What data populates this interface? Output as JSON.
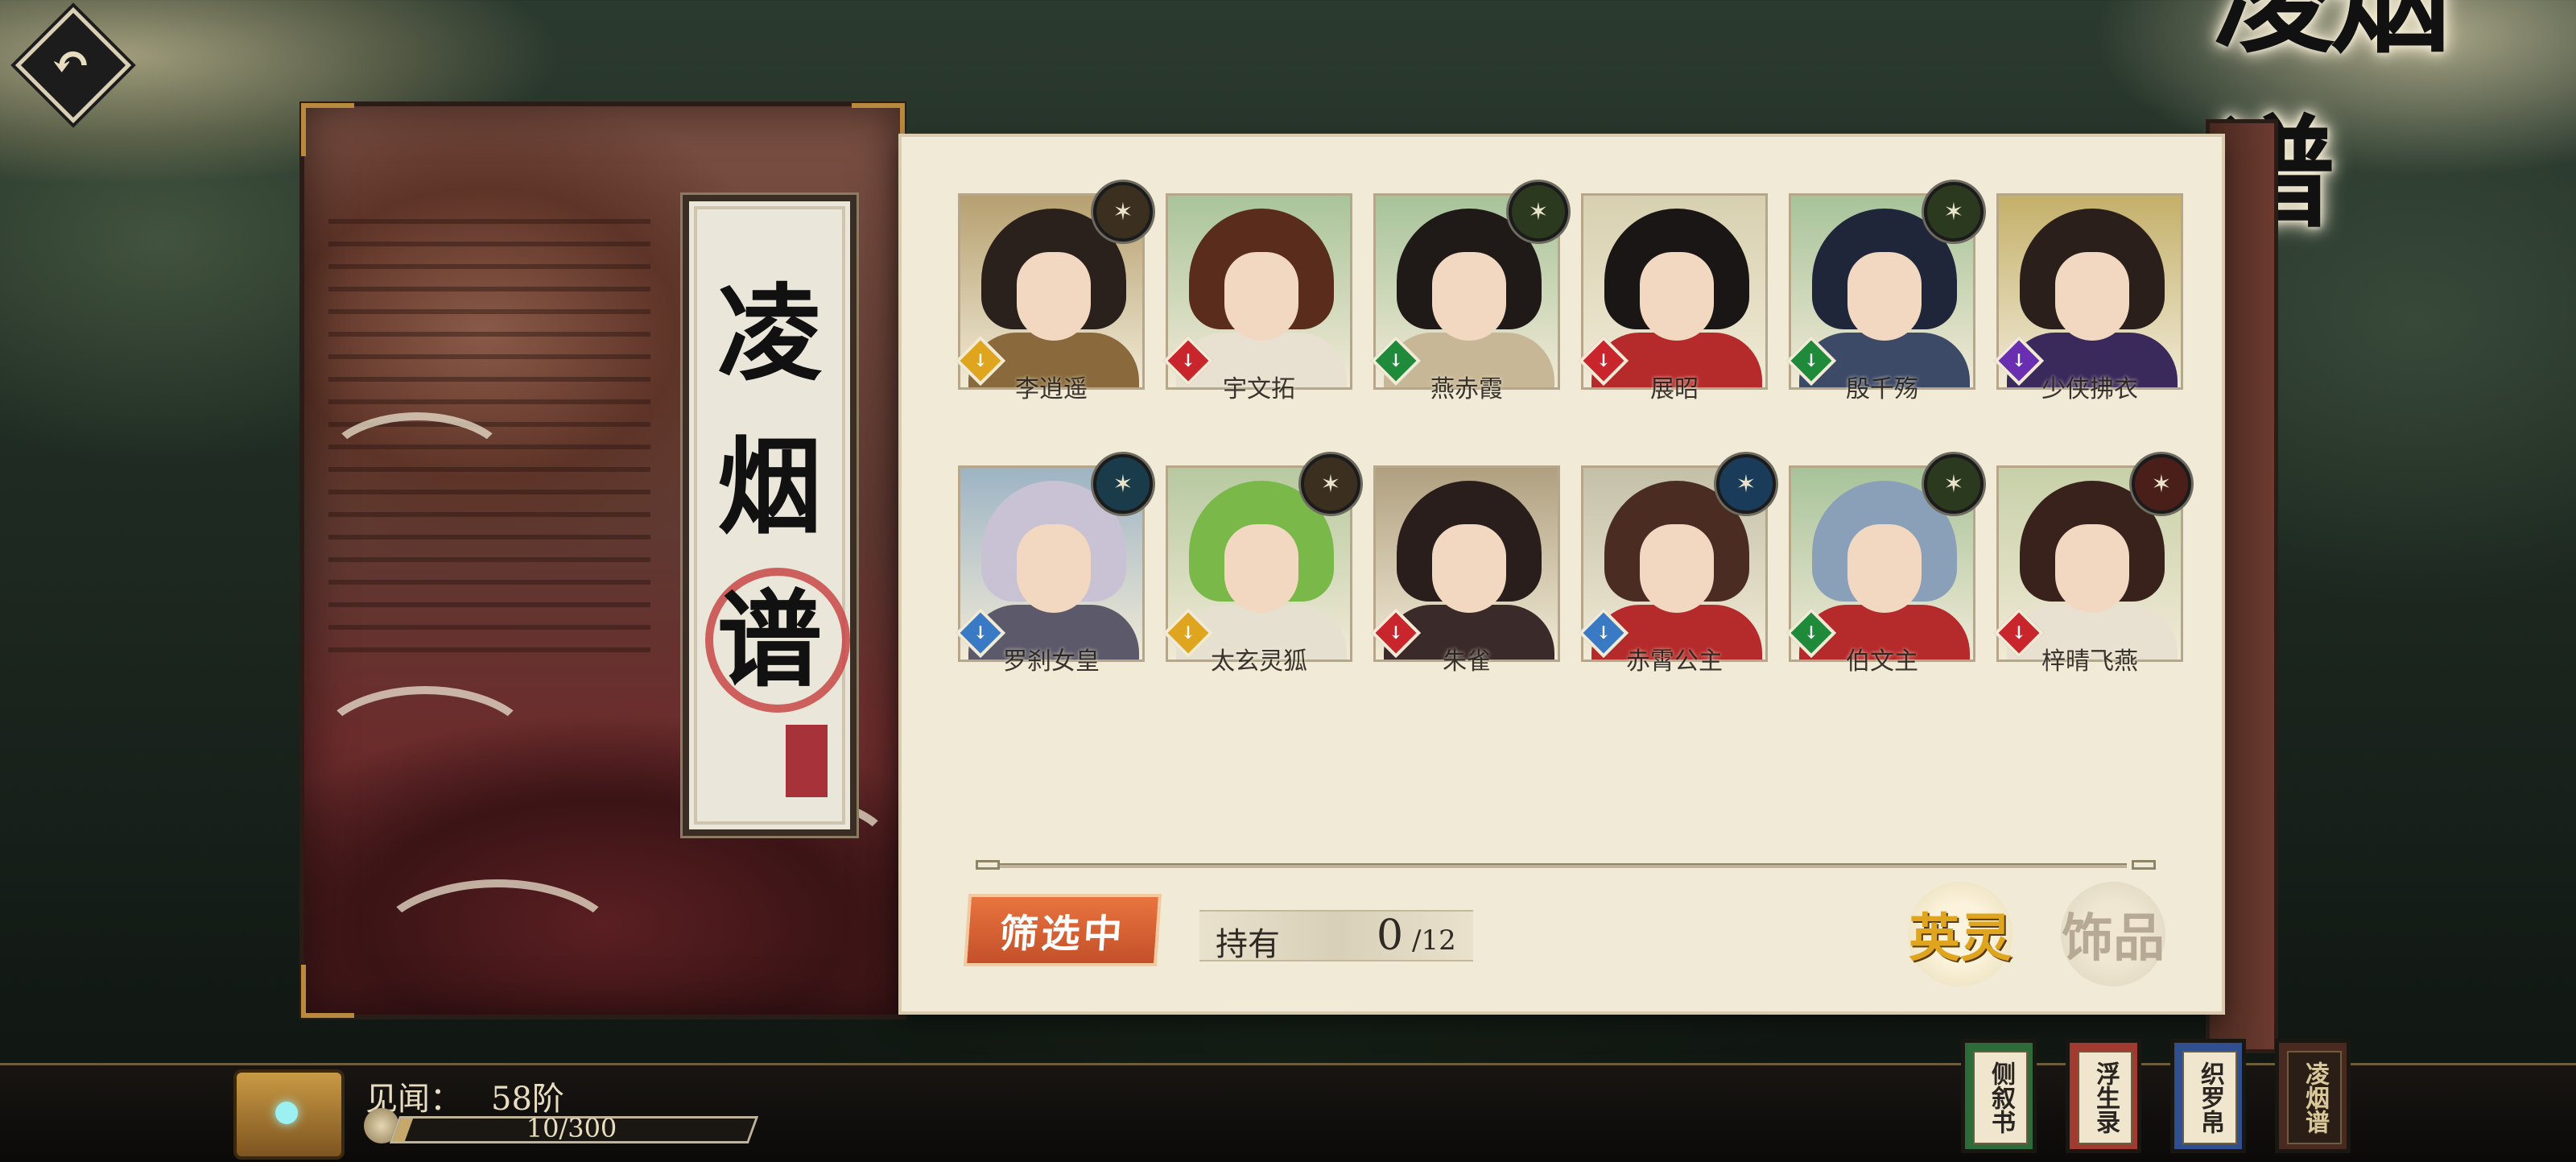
{
  "header": {
    "back_label": "",
    "title": "凌烟谱"
  },
  "book": {
    "title_chars": [
      "凌",
      "烟",
      "谱"
    ]
  },
  "roster": [
    {
      "name": "李逍遥",
      "element": "土",
      "badge_color": "#3b2f1f",
      "gem_color": "#e0a51e",
      "hair": "#2a211c",
      "robe": "#8a6a3c",
      "bg": "#b6a070"
    },
    {
      "name": "宇文拓",
      "element": "火",
      "badge_color": "",
      "gem_color": "#c9252c",
      "hair": "#5a2c1c",
      "robe": "#e8e0d0",
      "bg": "#a9c49a"
    },
    {
      "name": "燕赤霞",
      "element": "木",
      "badge_color": "#2b3a1f",
      "gem_color": "#1f8a3a",
      "hair": "#1f1a18",
      "robe": "#c7b796",
      "bg": "#a7c39a"
    },
    {
      "name": "展昭",
      "element": "火",
      "badge_color": "",
      "gem_color": "#c9252c",
      "hair": "#1a1615",
      "robe": "#b52a2a",
      "bg": "#d7d0b0"
    },
    {
      "name": "殷千殇",
      "element": "木",
      "badge_color": "#2b3a1f",
      "gem_color": "#1f8a3a",
      "hair": "#20263a",
      "robe": "#3c4a68",
      "bg": "#a7c39a"
    },
    {
      "name": "少侠拂衣",
      "element": "暗",
      "badge_color": "",
      "gem_color": "#6a2fb0",
      "hair": "#2a1f1a",
      "robe": "#3a2a5c",
      "bg": "#c4b06a"
    },
    {
      "name": "罗刹女皇",
      "element": "水",
      "badge_color": "#1a3b4a",
      "gem_color": "#3a7ac4",
      "hair": "#c9c2d4",
      "robe": "#5c5a6a",
      "bg": "#9db4c4"
    },
    {
      "name": "太玄灵狐",
      "element": "风",
      "badge_color": "#3b2f1f",
      "gem_color": "#e0a51e",
      "hair": "#7ab84a",
      "robe": "#e6e0d0",
      "bg": "#b7c9a0"
    },
    {
      "name": "朱雀",
      "element": "火",
      "badge_color": "",
      "gem_color": "#c9252c",
      "hair": "#2a1e1c",
      "robe": "#3a2a2a",
      "bg": "#b0a080"
    },
    {
      "name": "赤霄公主",
      "element": "水",
      "badge_color": "#1a3b5a",
      "gem_color": "#3a7ac4",
      "hair": "#4a2c22",
      "robe": "#b52a2a",
      "bg": "#c4c0a8"
    },
    {
      "name": "伯文主",
      "element": "木",
      "badge_color": "#2b3a1f",
      "gem_color": "#1f8a3a",
      "hair": "#8aa0b8",
      "robe": "#b52a2a",
      "bg": "#a7c39a"
    },
    {
      "name": "梓晴飞燕",
      "element": "火",
      "badge_color": "#4a1f1a",
      "gem_color": "#c9252c",
      "hair": "#3a221c",
      "robe": "#e8e0d0",
      "bg": "#c7d0a8"
    }
  ],
  "controls": {
    "filter_label": "筛选中",
    "owned_label": "持有",
    "owned_count": "0",
    "owned_total": "/12",
    "category_active": "英灵",
    "category_inactive": "饰品"
  },
  "footer": {
    "exp_label": "见闻：",
    "exp_level": "58阶",
    "exp_progress_text": "10/300",
    "exp_progress": 0.033,
    "tabs": [
      "侧叙书",
      "浮生录",
      "织罗帛",
      "凌烟谱"
    ]
  }
}
